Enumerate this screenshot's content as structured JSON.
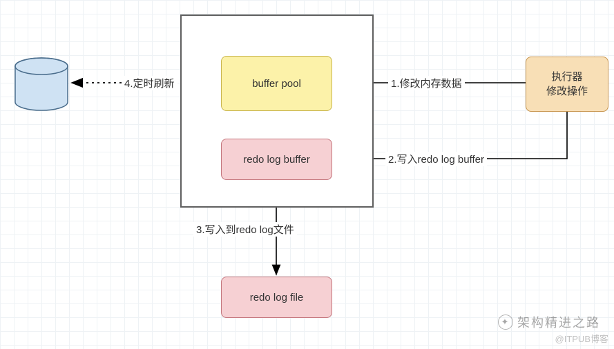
{
  "nodes": {
    "buffer_pool": "buffer pool",
    "redolog_buffer": "redo log buffer",
    "redolog_file": "redo log file",
    "executor_line1": "执行器",
    "executor_line2": "修改操作"
  },
  "arrows": {
    "a1": "1.修改内存数据",
    "a2": "2.写入redo log buffer",
    "a3": "3.写入到redo log文件",
    "a4": "4.定时刷新"
  },
  "watermark": {
    "main": "架构精进之路",
    "sub": "@ITPUB博客"
  }
}
